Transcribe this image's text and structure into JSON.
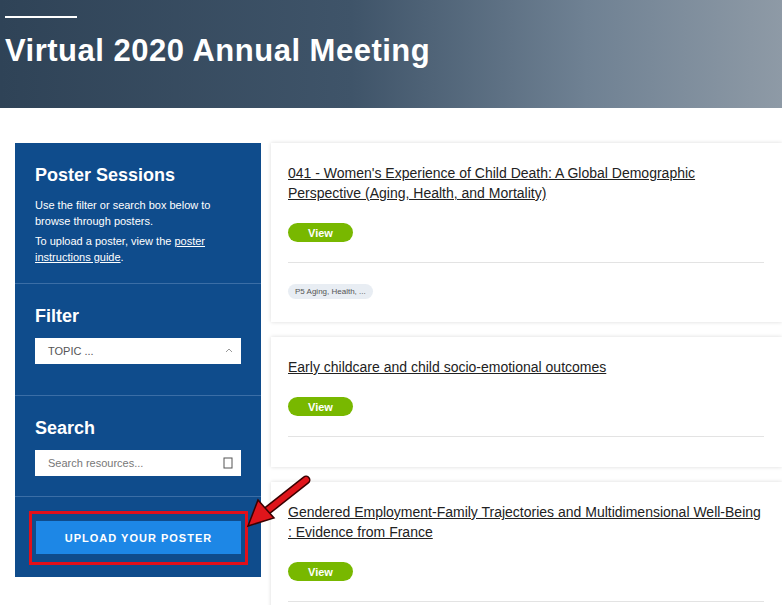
{
  "header": {
    "title": "Virtual 2020 Annual Meeting"
  },
  "sidebar": {
    "title": "Poster Sessions",
    "intro": "Use the filter or search box below to browse through posters.",
    "upload_text": "To upload a poster, view the",
    "upload_link": "poster instructions guide",
    "upload_end": ".",
    "filter": {
      "title": "Filter",
      "value": "TOPIC ..."
    },
    "search": {
      "title": "Search",
      "placeholder": "Search resources..."
    },
    "button": "UPLOAD YOUR POSTER"
  },
  "posters": [
    {
      "title": "041 - Women's Experience of Child Death: A Global Demographic Perspective (Aging, Health, and Mortality)",
      "button": "View",
      "tags": [
        "P5 Aging, Health, ..."
      ]
    },
    {
      "title": "Early childcare and child socio-emotional outcomes",
      "button": "View",
      "tags": []
    },
    {
      "title": "Gendered Employment-Family Trajectories and Multidimensional Well-Being : Evidence from France",
      "button": "View",
      "tags": []
    }
  ]
}
